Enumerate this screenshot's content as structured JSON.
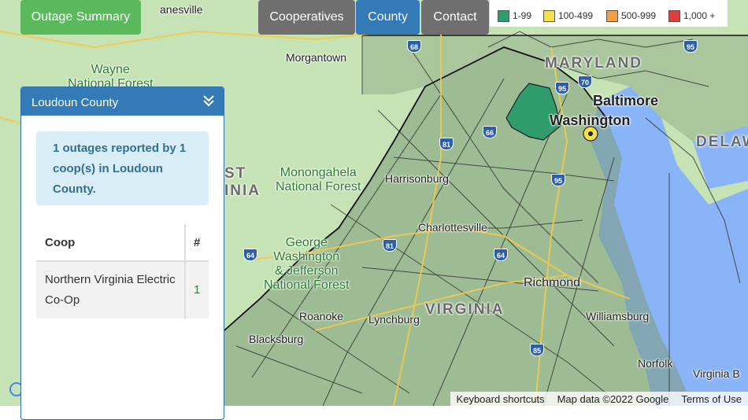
{
  "nav": {
    "summary_label": "Outage Summary",
    "coops_label": "Cooperatives",
    "county_label": "County",
    "contact_label": "Contact"
  },
  "legend": {
    "items": [
      {
        "label": "1-99",
        "color": "#2e9d6b"
      },
      {
        "label": "100-499",
        "color": "#f4e04d"
      },
      {
        "label": "500-999",
        "color": "#f0a04b"
      },
      {
        "label": "1,000 +",
        "color": "#d9413f"
      }
    ]
  },
  "panel": {
    "title": "Loudoun County",
    "alert": "1 outages reported by 1 coop(s) in Loudoun County.",
    "table": {
      "headers": [
        "Coop",
        "#"
      ],
      "rows": [
        {
          "coop": "Northern Virginia Electric Co-Op",
          "count": "1"
        }
      ]
    }
  },
  "map": {
    "labels": {
      "maryland": "MARYLAND",
      "virginia": "VIRGINIA",
      "delaware": "DELAW",
      "west_virginia": "ST\nINIA",
      "baltimore": "Baltimore",
      "washington": "Washington",
      "morgantown": "Morgantown",
      "harrisonburg": "Harrisonburg",
      "charlottesville": "Charlottesville",
      "richmond": "Richmond",
      "lynchburg": "Lynchburg",
      "roanoke": "Roanoke",
      "blacksburg": "Blacksburg",
      "williamsburg": "Williamsburg",
      "norfolk": "Norfolk",
      "virginia_beach": "Virginia B",
      "nanesville": "anesville",
      "wayne_forest": "Wayne\nNational Forest",
      "monongahela": "Monongahela\nNational Forest",
      "gw_forest": "George\nWashington\n& Jefferson\nNational Forest"
    },
    "shields": [
      "68",
      "81",
      "66",
      "70",
      "95",
      "95",
      "64",
      "81",
      "64",
      "85",
      "95"
    ],
    "highlight_color": "#2e9d6b"
  },
  "attribution": {
    "shortcuts": "Keyboard shortcuts",
    "data": "Map data ©2022 Google",
    "terms": "Terms of Use"
  }
}
